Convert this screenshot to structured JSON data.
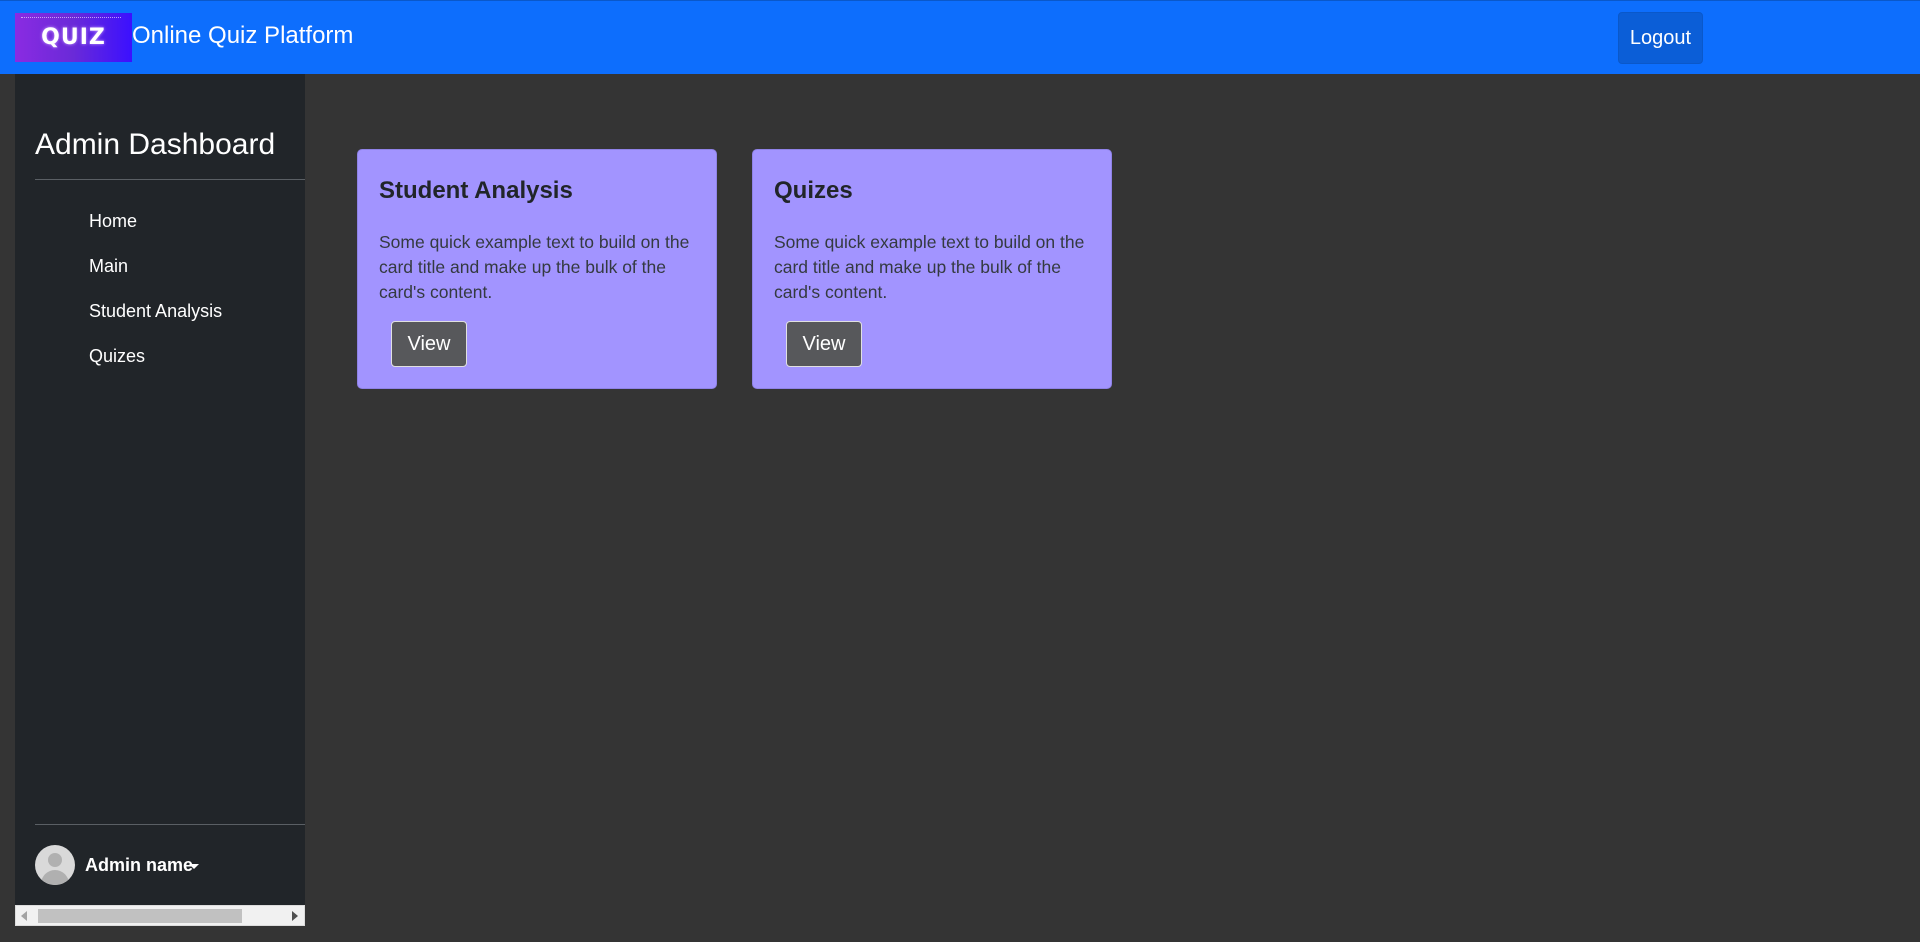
{
  "header": {
    "logo_text": "QUIZ",
    "brand": "Online Quiz Platform",
    "logout_label": "Logout",
    "color": "#0d6efd"
  },
  "sidebar": {
    "title": "Admin Dashboard",
    "items": [
      {
        "label": "Home"
      },
      {
        "label": "Main"
      },
      {
        "label": "Student Analysis"
      },
      {
        "label": "Quizes"
      }
    ],
    "user": {
      "name": "Admin name"
    }
  },
  "cards": [
    {
      "title": "Student Analysis",
      "text": "Some quick example text to build on the card title and make up the bulk of the card's content.",
      "button": "View"
    },
    {
      "title": "Quizes",
      "text": "Some quick example text to build on the card title and make up the bulk of the card's content.",
      "button": "View"
    }
  ],
  "colors": {
    "card_bg": "#a294ff",
    "sidebar_bg": "#212529",
    "page_bg": "#343434"
  }
}
